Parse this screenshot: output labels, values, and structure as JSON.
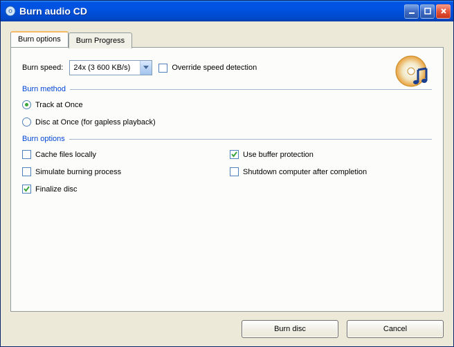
{
  "window": {
    "title": "Burn audio CD"
  },
  "tabs": {
    "options": "Burn options",
    "progress": "Burn Progress"
  },
  "speed": {
    "label": "Burn speed:",
    "value": "24x (3 600 KB/s)"
  },
  "override": {
    "label": "Override speed detection",
    "checked": false
  },
  "method": {
    "header": "Burn method",
    "trackAtOnce": "Track at Once",
    "discAtOnce": "Disc at Once (for gapless playback)",
    "selected": "trackAtOnce"
  },
  "options": {
    "header": "Burn options",
    "cache": {
      "label": "Cache files locally",
      "checked": false
    },
    "buffer": {
      "label": "Use buffer protection",
      "checked": true
    },
    "simulate": {
      "label": "Simulate burning process",
      "checked": false
    },
    "shutdown": {
      "label": "Shutdown computer after completion",
      "checked": false
    },
    "finalize": {
      "label": "Finalize disc",
      "checked": true
    }
  },
  "buttons": {
    "burn": "Burn disc",
    "cancel": "Cancel"
  }
}
